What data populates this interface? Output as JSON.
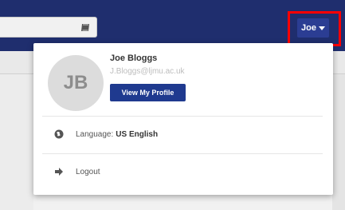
{
  "header": {
    "user_button_label": "Joe",
    "search_icon": "book-icon",
    "user_caret_icon": "caret-down-icon",
    "highlight_color": "#ff0000"
  },
  "profile": {
    "initials": "JB",
    "name": "Joe Bloggs",
    "email": "J.Bloggs@ljmu.ac.uk",
    "view_profile_label": "View My Profile"
  },
  "menu": {
    "language_label": "Language:",
    "language_value": "US English",
    "language_icon": "globe-icon",
    "logout_label": "Logout",
    "logout_icon": "sign-out-icon"
  },
  "colors": {
    "header_bg": "#1f2e6e",
    "button_bg": "#1f3a8f"
  }
}
